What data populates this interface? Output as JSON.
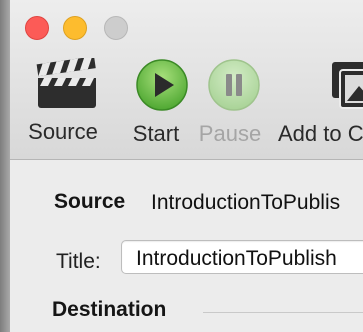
{
  "window": {
    "controls": [
      "close",
      "minimize",
      "zoom"
    ]
  },
  "toolbar": {
    "items": [
      {
        "label": "Source",
        "icon": "clapperboard-icon",
        "enabled": true
      },
      {
        "label": "Start",
        "icon": "play-icon",
        "enabled": true
      },
      {
        "label": "Pause",
        "icon": "pause-icon",
        "enabled": false
      },
      {
        "label": "Add to C",
        "icon": "photos-icon",
        "enabled": true
      }
    ]
  },
  "form": {
    "source_label": "Source",
    "source_value": "IntroductionToPublis",
    "title_label": "Title:",
    "title_value": "IntroductionToPublish",
    "destination_label": "Destination"
  },
  "colors": {
    "close": "#fc5b57",
    "minimize": "#fdbc2e",
    "zoom_disabled": "#cdcdcd",
    "start_green": "#5ab53c"
  }
}
